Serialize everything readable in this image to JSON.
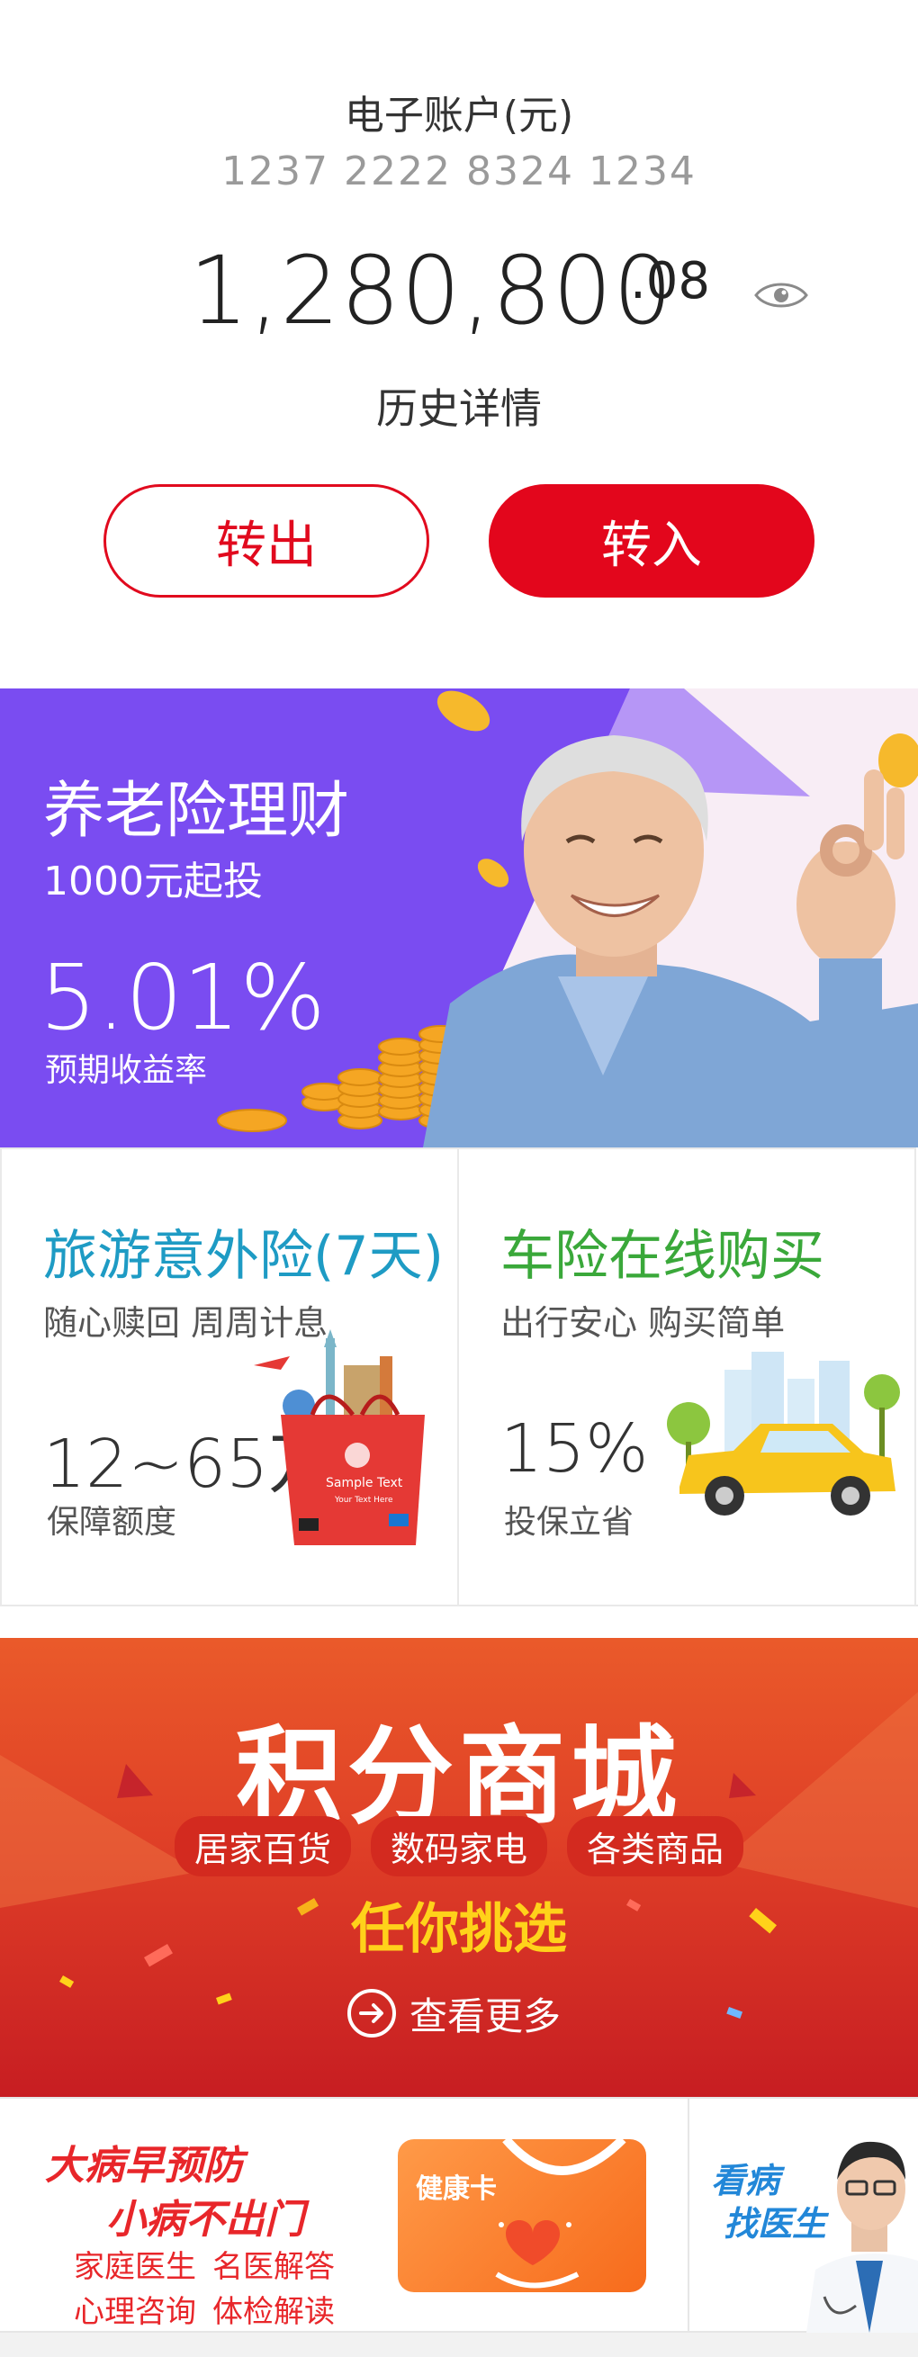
{
  "account": {
    "title": "电子账户(元)",
    "number": "1237 2222 8324 1234",
    "balance_integer": "1,280,800",
    "balance_cents": ".08",
    "visibility_icon": "eye-icon",
    "history_label": "历史详情",
    "transfer_out_label": "转出",
    "transfer_in_label": "转入",
    "accent_color": "#e3061c"
  },
  "pension_banner": {
    "title": "养老险理财",
    "subtitle": "1000元起投",
    "rate": "5.01%",
    "rate_label": "预期收益率",
    "bg_color": "#7b4cf0"
  },
  "products": [
    {
      "title": "旅游意外险(7天)",
      "subtitle": "随心赎回 周周计息",
      "value": "12~65万",
      "value_label": "保障额度",
      "title_color": "#1e9bc4",
      "image_icon": "shopping-bag-icon",
      "bag_text": "Sample Text",
      "bag_subtext": "Your Text Here"
    },
    {
      "title": "车险在线购买",
      "subtitle": "出行安心 购买简单",
      "value": "15%",
      "value_label": "投保立省",
      "title_color": "#3aa83a",
      "image_icon": "car-icon"
    }
  ],
  "mall": {
    "title": "积分商城",
    "tags": [
      "居家百货",
      "数码家电",
      "各类商品"
    ],
    "slogan": "任你挑选",
    "more_label": "查看更多",
    "more_icon": "arrow-right-circle-icon"
  },
  "health": {
    "slogan_line1": "大病早预防",
    "slogan_line2": "小病不出门",
    "links": [
      "家庭医生",
      "名医解答",
      "心理咨询",
      "体检解读"
    ],
    "card_label": "健康卡",
    "doctor_line1": "看病",
    "doctor_line2": "找医生",
    "accent_color": "#e8262a",
    "doctor_color": "#2287d8"
  }
}
